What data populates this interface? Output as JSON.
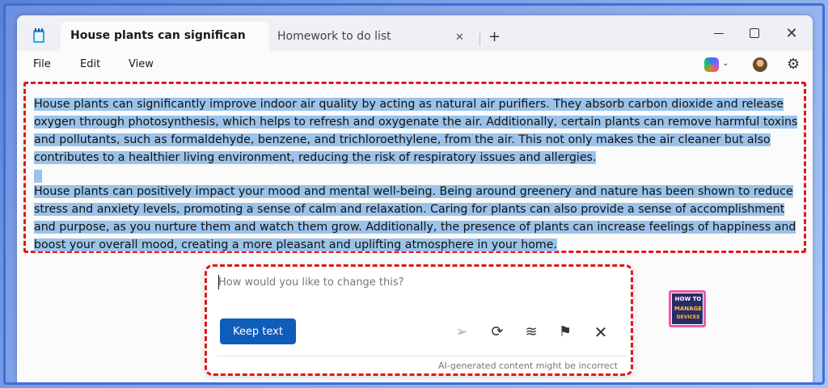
{
  "tabs": {
    "active_label": "House plants can significan",
    "inactive_label": "Homework to do list",
    "close_glyph": "✕",
    "add_glyph": "+"
  },
  "window_controls": {
    "close_glyph": "✕"
  },
  "menu": {
    "file": "File",
    "edit": "Edit",
    "view": "View",
    "settings_glyph": "⚙",
    "copilot_chevron": "⌄"
  },
  "document": {
    "paragraphs": [
      "House plants can significantly improve indoor air quality by acting as natural air purifiers. They absorb carbon dioxide and release oxygen through photosynthesis, which helps to refresh and oxygenate the air. Additionally, certain plants can remove harmful toxins and pollutants, such as formaldehyde, benzene, and trichloroethylene, from the air. This not only makes the air cleaner but also contributes to a healthier living environment, reducing the risk of respiratory issues and allergies.",
      "House plants can positively impact your mood and mental well-being. Being around greenery and nature has been shown to reduce stress and anxiety levels, promoting a sense of calm and relaxation. Caring for plants can also provide a sense of accomplishment and purpose, as you nurture them and watch them grow. Additionally, the presence of plants can increase feelings of happiness and boost your overall mood, creating a more pleasant and uplifting atmosphere in your home."
    ],
    "selection_color": "#9bc3ea"
  },
  "rewrite_popup": {
    "input_placeholder": "How would you like to change this?",
    "input_value": "",
    "keep_button": "Keep text",
    "icons": {
      "send": "➢",
      "refresh": "⟳",
      "stack": "≋",
      "flag": "⚑",
      "close": "✕"
    },
    "disclaimer": "AI-generated content might be incorrect"
  },
  "logo": {
    "top": "HOW TO",
    "mid": "MANAGE",
    "bot": "DEVICES"
  },
  "colors": {
    "accent": "#0f5cba",
    "annotation": "#e01818",
    "frame": "#3d6fd9"
  }
}
